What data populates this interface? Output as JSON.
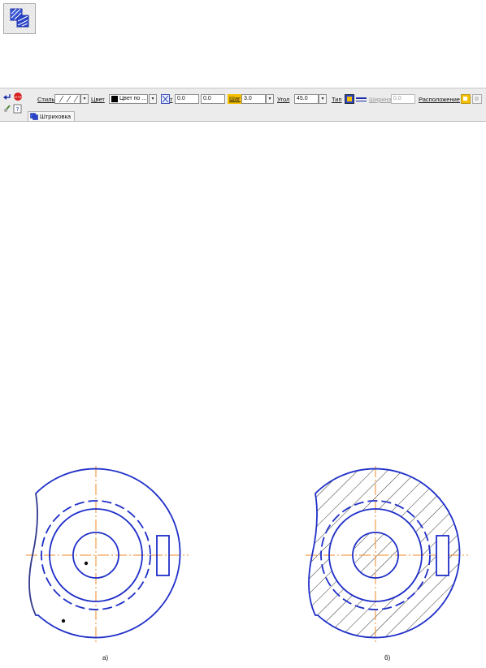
{
  "toolbar": {
    "style_label": "Стиль",
    "color_label": "Цвет",
    "color_value": "Цвет по ...",
    "x_label": "т",
    "x_value": "0.0",
    "y_value": "0.0",
    "step_label": "Шаг",
    "step_value": "3.0",
    "angle_label": "Угол",
    "angle_value": "45.0",
    "type_label": "Тип",
    "width_label": "Ширина",
    "width_value": "0.0",
    "position_label": "Расположение",
    "tab_label": "Штриховка"
  },
  "icons": [
    "hatch-tool-icon",
    "enter-icon",
    "stop-icon",
    "edit-icon",
    "help-icon",
    "hatch-tab-icon",
    "type-fill-icon",
    "type-line-icon",
    "position-icon"
  ],
  "colors": {
    "contour": "#1f2fc8",
    "axis": "#f08a24",
    "step_highlight": "#f5c000",
    "toolbar_bg": "#ececec"
  },
  "figures": {
    "a_caption": "а)",
    "b_caption": "б)"
  }
}
